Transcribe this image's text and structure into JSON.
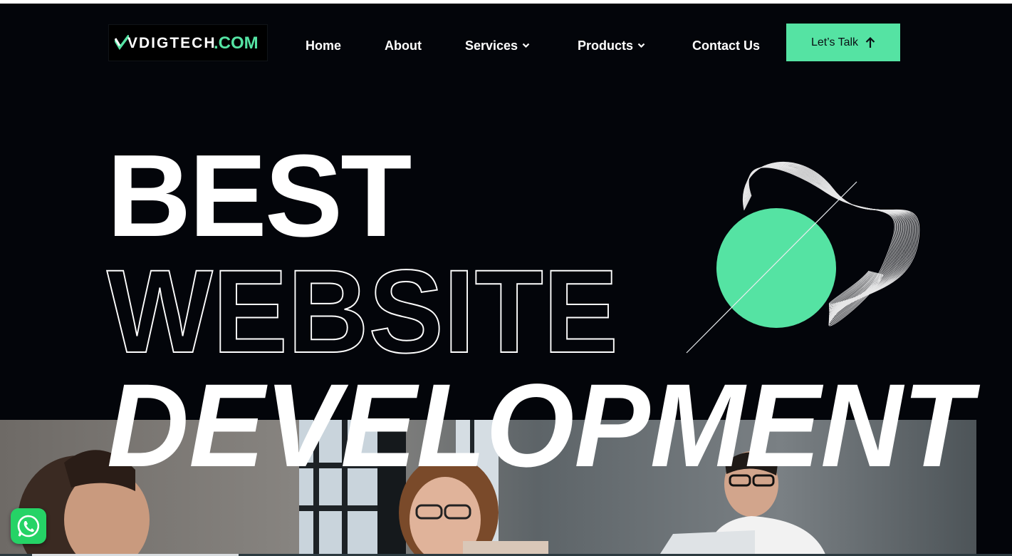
{
  "brand": {
    "name": "VDIGTECH",
    "suffix": ".COM",
    "accent_color": "#55e3a3"
  },
  "nav": {
    "home": "Home",
    "about": "About",
    "services": "Services",
    "products": "Products",
    "contact": "Contact Us"
  },
  "cta": {
    "label": "Let’s Talk",
    "icon": "arrow-up-icon"
  },
  "hero": {
    "line1": "BEST",
    "line2": "WEBSITE",
    "line3": "DEVELOPMENT",
    "background_color": "#03050a"
  },
  "floating": {
    "whatsapp_icon": "whatsapp-icon"
  }
}
